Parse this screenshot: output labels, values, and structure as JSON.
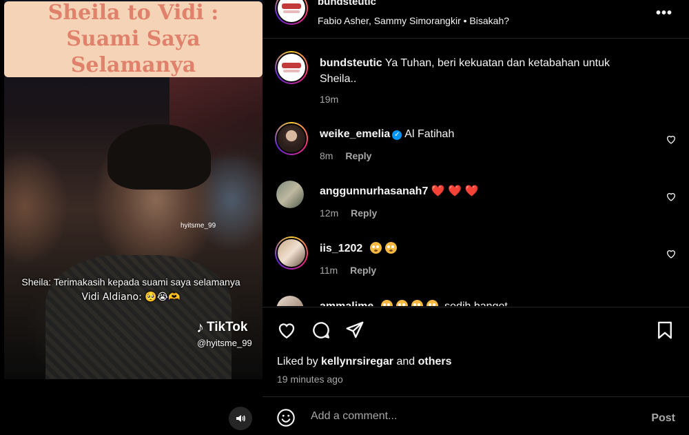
{
  "video": {
    "title_line1": "Sheila to Vidi :",
    "title_line2": "Suami Saya Selamanya",
    "small_watermark": "hyitsme_99",
    "caption_line1": "Sheila: Terimakasih kepada suami saya selamanya",
    "caption_line2": "Vidi Aldiano: 🥺😭🫶",
    "tiktok_brand": "TikTok",
    "tiktok_handle": "@hyitsme_99",
    "mute_icon": "speaker-icon"
  },
  "header": {
    "username": "bundsteutic",
    "subtitle": "Fabio Asher, Sammy Simorangkir • Bisakah?"
  },
  "comments": [
    {
      "user": "bundsteutic",
      "text": "Ya Tuhan, beri kekuatan dan ketabahan untuk Sheila..",
      "time": "19m"
    },
    {
      "user": "weike_emelia",
      "verified": true,
      "text": "Al Fatihah",
      "time": "8m",
      "reply": "Reply"
    },
    {
      "user": "anggunnurhasanah7",
      "text": "❤️ ❤️ ❤️",
      "time": "12m",
      "reply": "Reply"
    },
    {
      "user": "iis_1202",
      "text": "",
      "time": "11m",
      "reply": "Reply"
    },
    {
      "user": "ammalime",
      "text": "sedih banget",
      "time": "",
      "reply": ""
    }
  ],
  "actions": {
    "liked_prefix": "Liked by",
    "liked_user": "kellynrsiregar",
    "liked_and": "and",
    "liked_others": "others",
    "time_ago": "19 minutes ago"
  },
  "comment_box": {
    "placeholder": "Add a comment...",
    "post_label": "Post"
  },
  "colors": {
    "background": "#000000",
    "title_card": "#f4d3b6",
    "title_text": "#e0826b",
    "verified": "#0095f6",
    "muted_text": "#a8a8a8"
  }
}
